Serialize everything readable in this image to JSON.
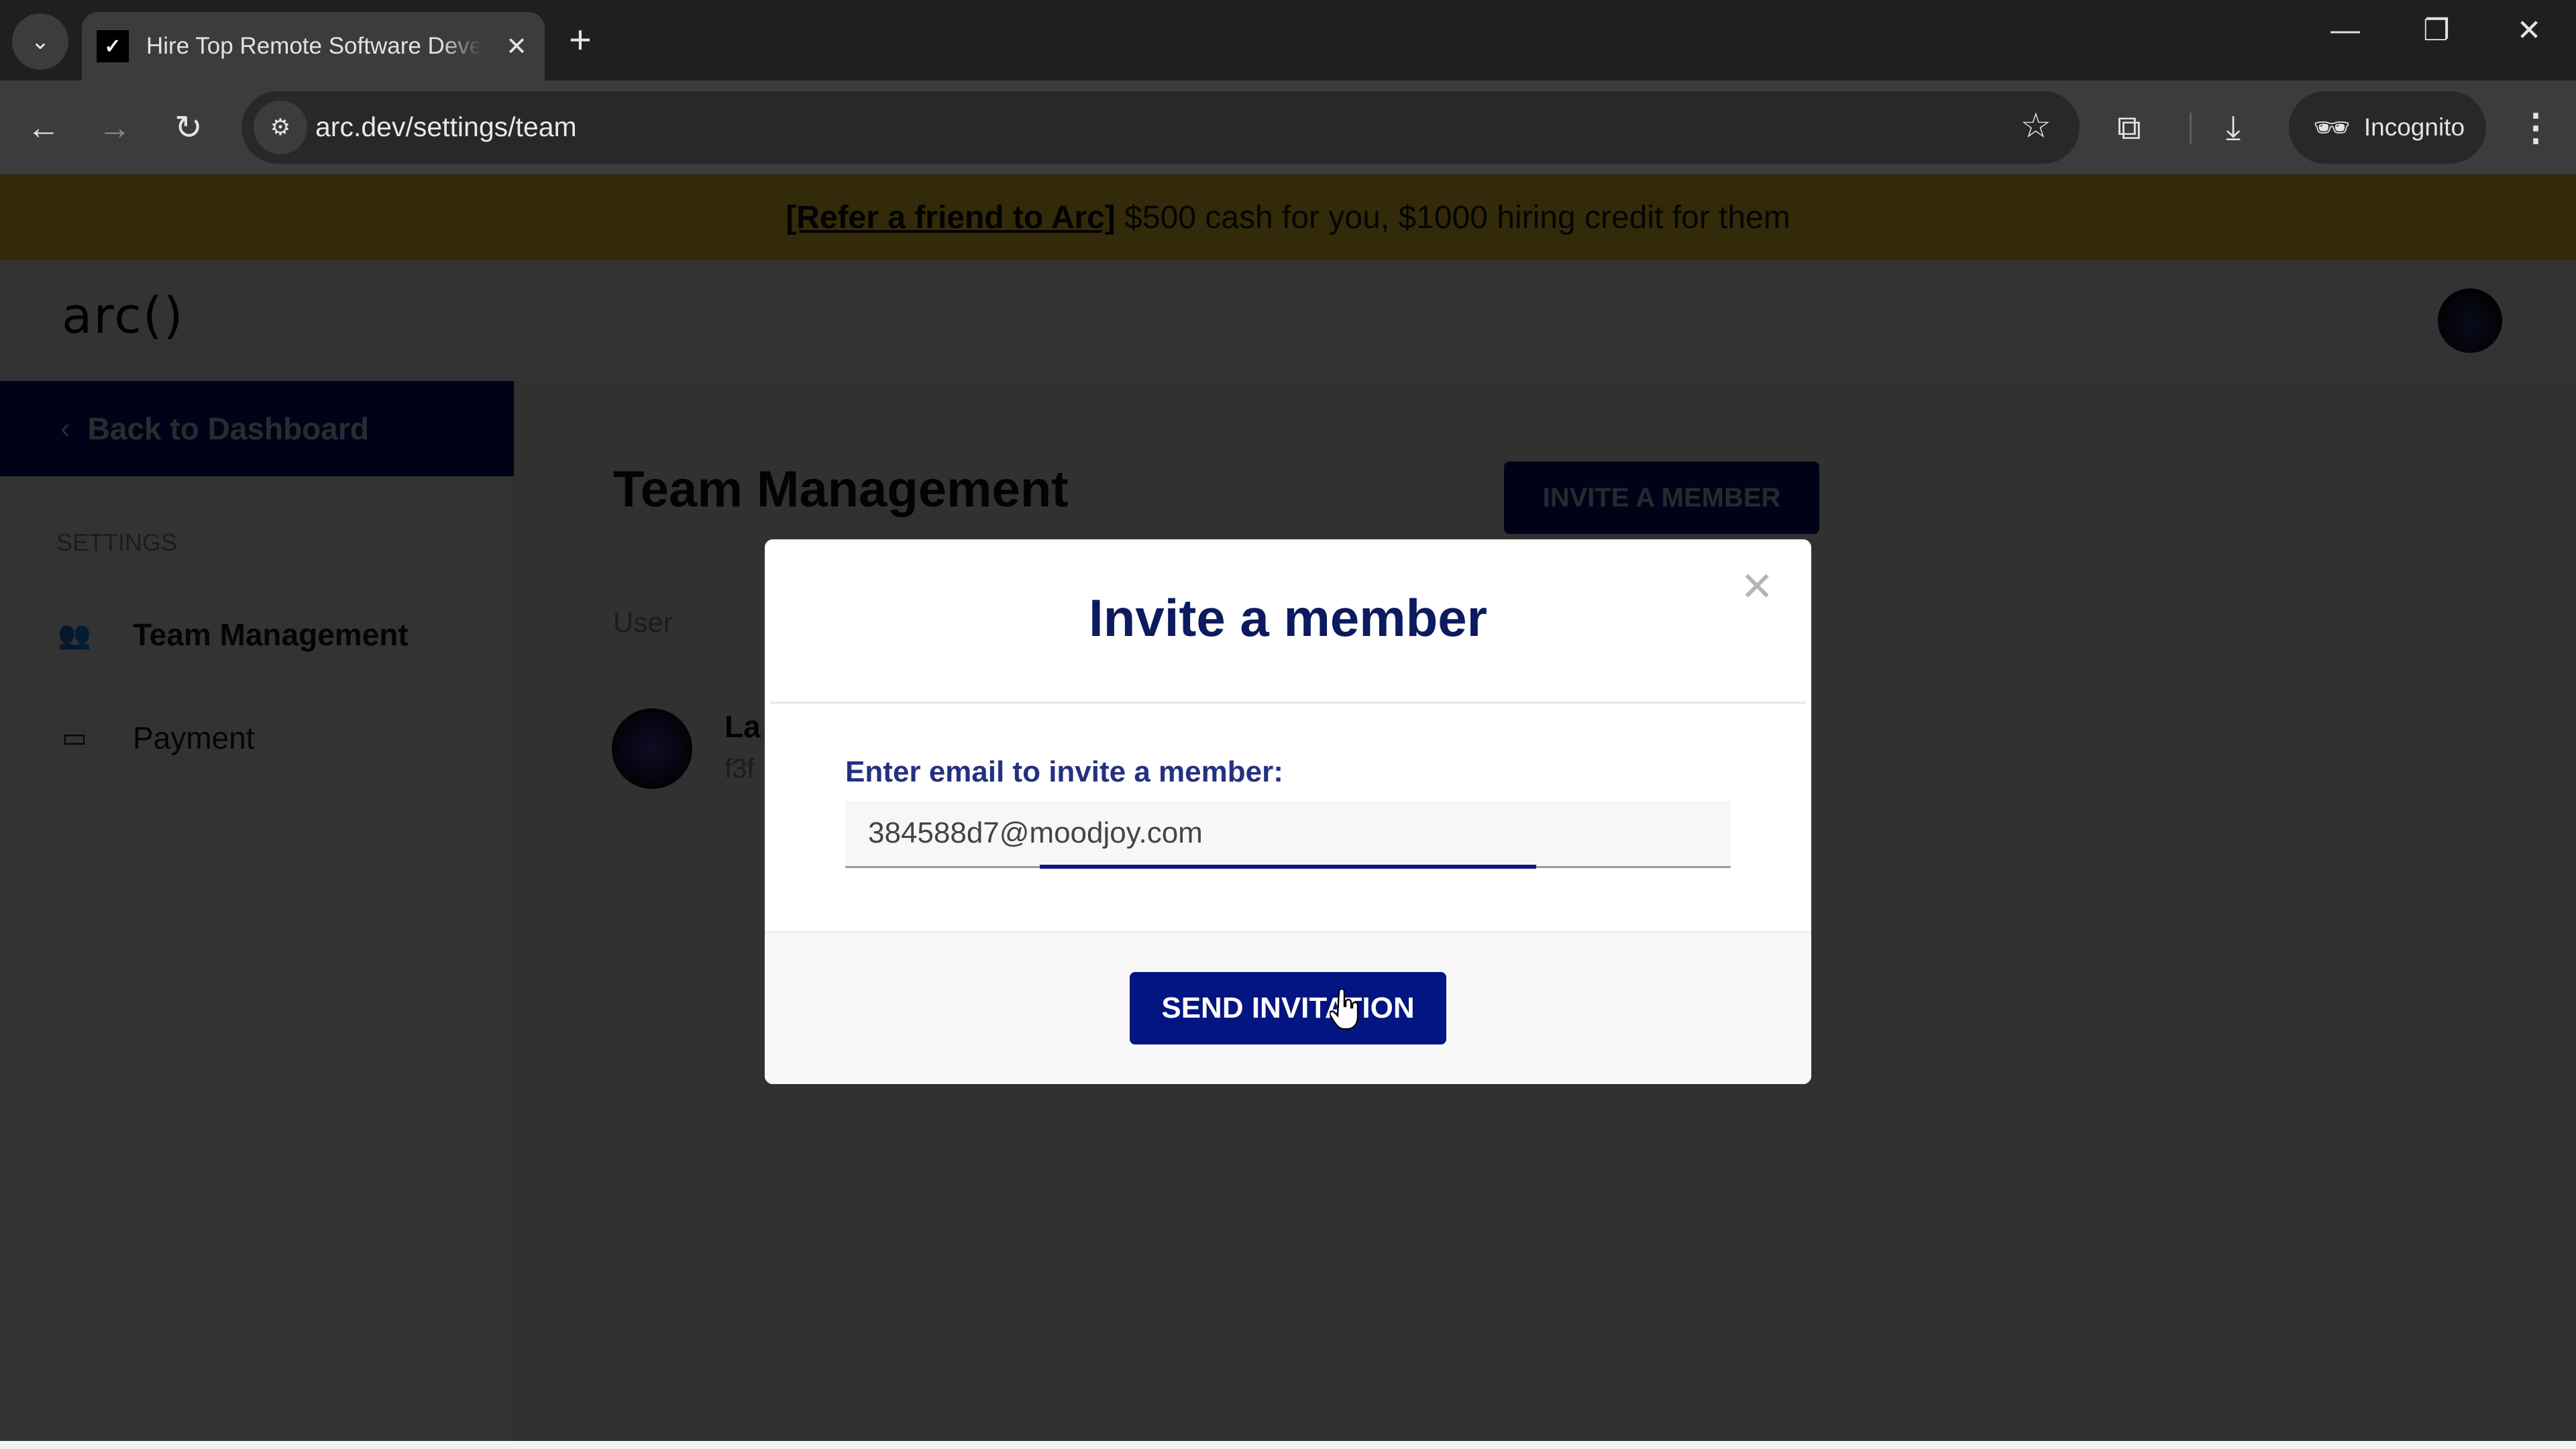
{
  "browser": {
    "tab": {
      "favicon": "✓",
      "title": "Hire Top Remote Software Developers"
    },
    "new_tab_icon": "+",
    "window_controls": {
      "minimize": "—",
      "restore": "❐",
      "close": "✕"
    },
    "url": "arc.dev/settings/team",
    "profile_label": "Incognito"
  },
  "banner": {
    "link_text": "[Refer a friend to Arc]",
    "text": " $500 cash for you, $1000 hiring credit for them"
  },
  "header": {
    "logo": "arc()"
  },
  "sidebar": {
    "back_label": "Back to Dashboard",
    "section_label": "SETTINGS",
    "items": [
      {
        "label": "Team Management",
        "icon": "team-icon",
        "active": true
      },
      {
        "label": "Payment",
        "icon": "credit-card-icon",
        "active": false
      }
    ]
  },
  "main": {
    "title": "Team Management",
    "invite_button": "INVITE A MEMBER",
    "table": {
      "columns": [
        "User"
      ],
      "rows": [
        {
          "name_partial": "La",
          "sub_partial": "f3f"
        }
      ]
    }
  },
  "modal": {
    "title": "Invite a member",
    "close_icon": "✕",
    "field_label": "Enter email to invite a member:",
    "email_value": "384588d7@moodjoy.com",
    "submit_label": "SEND INVITATION"
  }
}
